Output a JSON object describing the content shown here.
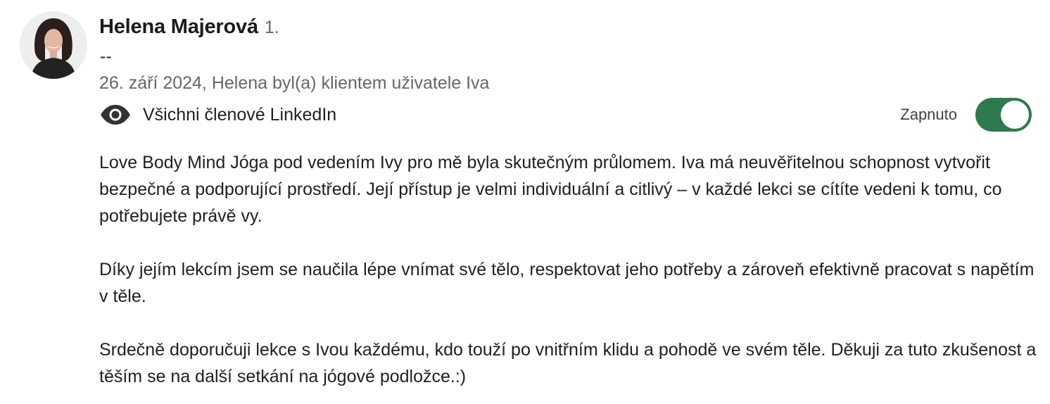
{
  "recommendation": {
    "author": {
      "name": "Helena Majerová",
      "degree": "1.",
      "headline": "--",
      "avatar_icon": "profile-photo"
    },
    "meta": "26. září 2024, Helena byl(a) klientem uživatele Iva",
    "visibility": {
      "icon": "eye-icon",
      "label": "Všichni členové LinkedIn"
    },
    "display_toggle": {
      "label": "Zapnuto",
      "state": "on",
      "accent_color": "#2e7a4f"
    },
    "text_paragraphs": [
      "Love Body Mind Jóga pod vedením Ivy pro mě byla skutečným průlomem. Iva má neuvěřitelnou schopnost vytvořit bezpečné a podporující prostředí. Její přístup je velmi individuální a citlivý – v každé lekci se cítíte vedeni k tomu, co potřebujete právě vy.",
      "Díky jejím lekcím jsem se naučila lépe vnímat své tělo, respektovat jeho potřeby a zároveň efektivně pracovat s napětím v těle.",
      "Srdečně doporučuji lekce s Ivou každému, kdo touží po vnitřním klidu a pohodě ve svém těle. Děkuji za tuto zkušenost a těším se na další setkání na jógové podložce.:)"
    ]
  }
}
